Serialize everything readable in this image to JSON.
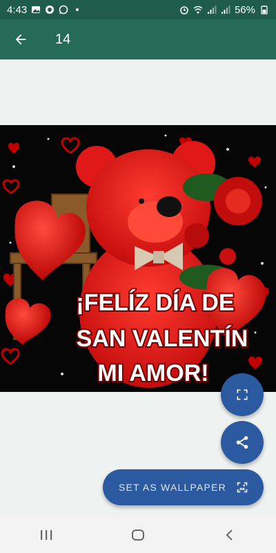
{
  "status_bar": {
    "time": "4:43",
    "battery": "56%",
    "icons_left": [
      "image-icon",
      "chat-icon",
      "whatsapp-icon",
      "dot-icon"
    ],
    "icons_right": [
      "alarm-icon",
      "wifi-icon",
      "signal-icon",
      "signal-icon",
      "battery-icon"
    ]
  },
  "app_bar": {
    "title": "14",
    "back_icon": "arrow-left-icon"
  },
  "wallpaper": {
    "text_line1": "¡FELÍZ DÍA DE",
    "text_line2": "SAN VALENTÍN",
    "text_line3": "MI AMOR!"
  },
  "actions": {
    "expand_icon": "fullscreen-icon",
    "share_icon": "share-icon",
    "set_wallpaper_label": "SET AS WALLPAPER",
    "set_wallpaper_icon": "wallpaper-icon"
  },
  "nav_bar": {
    "buttons": [
      "recents-icon",
      "home-icon",
      "back-icon"
    ]
  },
  "colors": {
    "status_bar": "#1f5c4c",
    "app_bar": "#256b58",
    "fab": "#2c5aa0",
    "background": "#eef3f2"
  }
}
